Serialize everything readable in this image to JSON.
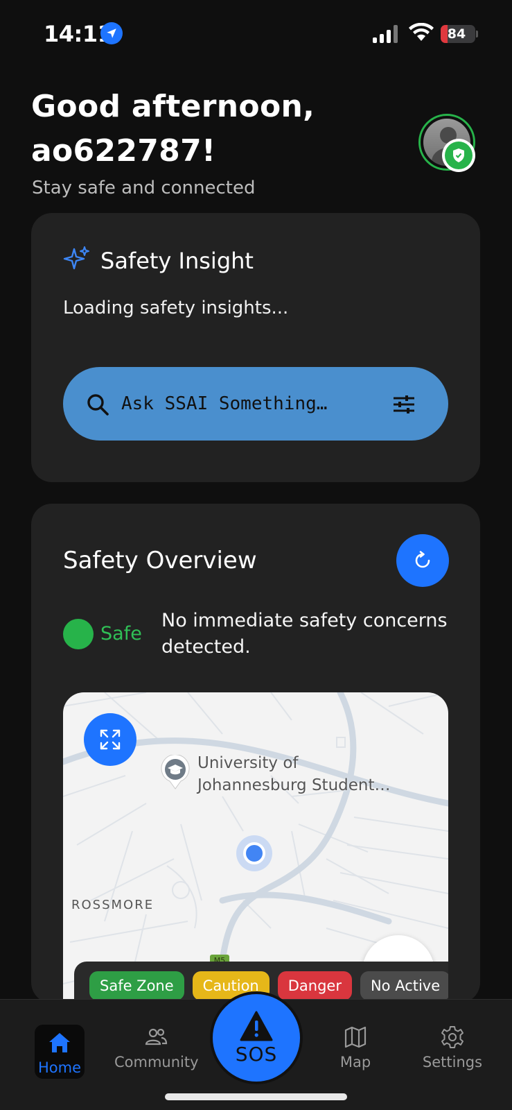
{
  "status_bar": {
    "time": "14:11",
    "battery": "84"
  },
  "header": {
    "greeting": "Good afternoon, ao622787!",
    "subtitle": "Stay safe and connected"
  },
  "insight": {
    "title": "Safety Insight",
    "text": "Loading safety insights...",
    "search_placeholder": "Ask SSAI Something…"
  },
  "overview": {
    "title": "Safety Overview",
    "status_label": "Safe",
    "status_text": "No immediate safety concerns detected.",
    "map": {
      "poi_label_line1": "University of",
      "poi_label_line2": "Johannesburg Student…",
      "area_label": "ROSSMORE",
      "road_shield": "M5"
    },
    "legend": [
      "Safe Zone",
      "Caution",
      "Danger",
      "No Active"
    ]
  },
  "tabs": {
    "home": "Home",
    "community": "Community",
    "sos": "SOS",
    "map": "Map",
    "settings": "Settings"
  },
  "colors": {
    "accent": "#1e74ff",
    "safe": "#27b34a",
    "caution": "#e6b719",
    "danger": "#d9363e",
    "search_bar": "#4a8fce"
  }
}
